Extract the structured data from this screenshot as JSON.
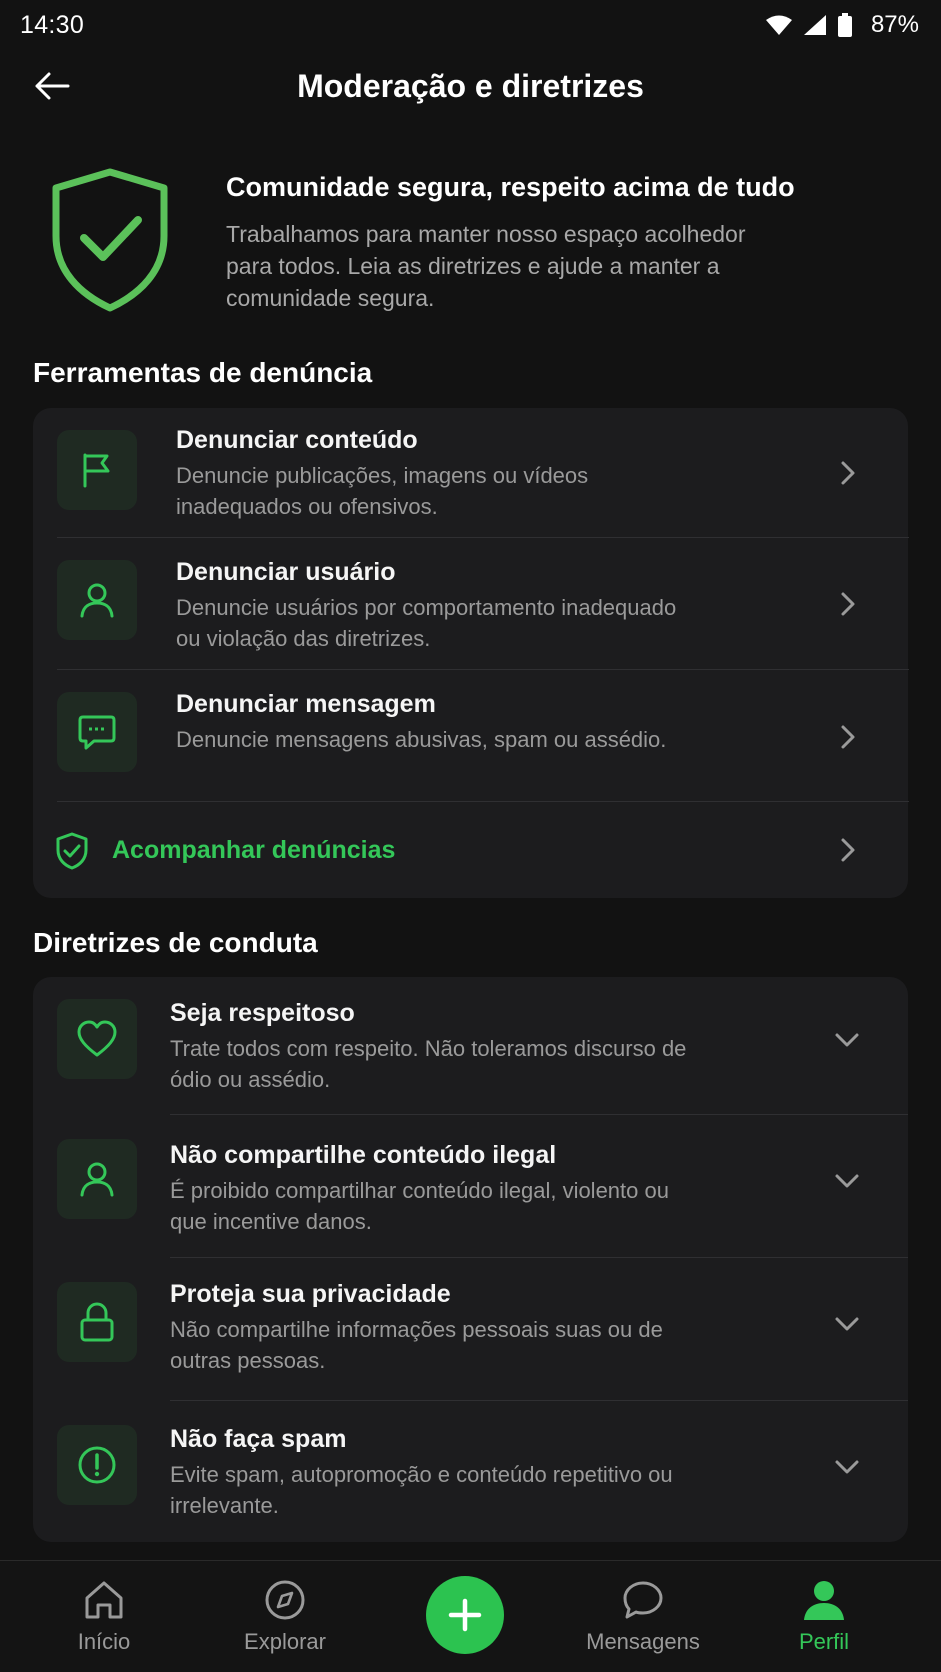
{
  "status_bar": {
    "time": "14:30",
    "battery": "87%"
  },
  "header": {
    "title": "Moderação e diretrizes"
  },
  "hero": {
    "title": "Comunidade segura, respeito acima de tudo",
    "text": "Trabalhamos para manter nosso espaço acolhedor para todos. Leia as diretrizes e ajude a manter a comunidade segura."
  },
  "report_section": {
    "title": "Ferramentas de denúncia",
    "items": [
      {
        "icon": "flag-icon",
        "title": "Denunciar conteúdo",
        "desc": "Denuncie publicações, imagens ou vídeos inadequados ou ofensivos."
      },
      {
        "icon": "user-icon",
        "title": "Denunciar usuário",
        "desc": "Denuncie usuários por comportamento inadequado ou violação das diretrizes."
      },
      {
        "icon": "message-icon",
        "title": "Denunciar mensagem",
        "desc": "Denuncie mensagens abusivas, spam ou assédio."
      }
    ],
    "track_label": "Acompanhar denúncias"
  },
  "guidelines_section": {
    "title": "Diretrizes de conduta",
    "items": [
      {
        "icon": "heart-icon",
        "title": "Seja respeitoso",
        "desc": "Trate todos com respeito. Não toleramos discurso de ódio ou assédio."
      },
      {
        "icon": "user-icon",
        "title": "Não compartilhe conteúdo ilegal",
        "desc": "É proibido compartilhar conteúdo ilegal, violento ou que incentive danos."
      },
      {
        "icon": "lock-icon",
        "title": "Proteja sua privacidade",
        "desc": "Não compartilhe informações pessoais suas ou de outras pessoas."
      },
      {
        "icon": "alert-icon",
        "title": "Não faça spam",
        "desc": "Evite spam, autopromoção e conteúdo repetitivo ou irrelevante."
      }
    ]
  },
  "bottom_nav": {
    "items": [
      {
        "icon": "home-icon",
        "label": "Início"
      },
      {
        "icon": "compass-icon",
        "label": "Explorar"
      },
      {
        "icon": "chat-icon",
        "label": "Mensagens"
      },
      {
        "icon": "profile-icon",
        "label": "Perfil"
      }
    ],
    "active": "Perfil"
  },
  "colors": {
    "accent": "#34c759",
    "background": "#121212",
    "card": "#1c1c1e"
  }
}
